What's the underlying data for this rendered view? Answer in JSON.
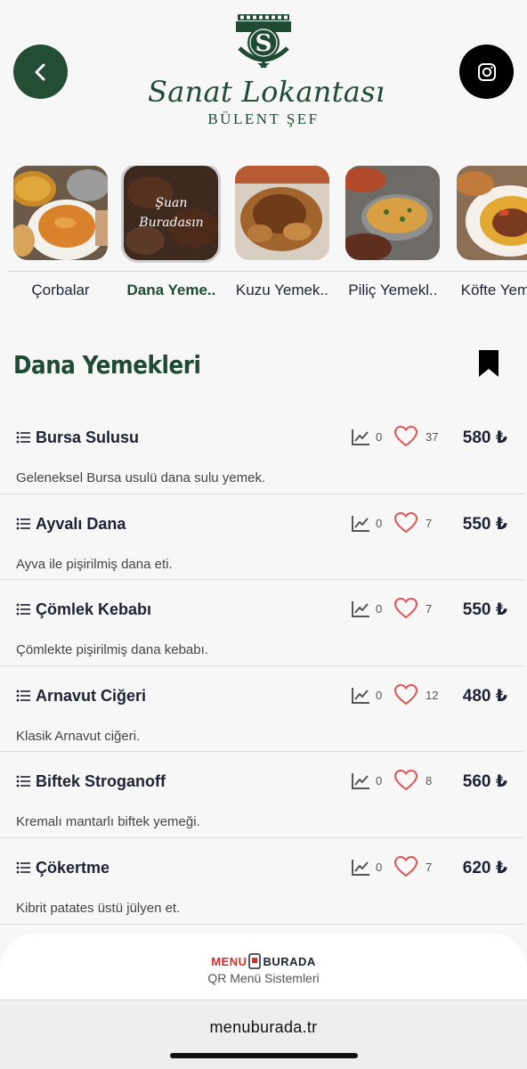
{
  "header": {
    "restaurant_name": "Sanat Lokantası",
    "chef_line": "BÜLENT ŞEF",
    "back_icon": "chevron-left-icon",
    "social_icon": "instagram-icon"
  },
  "categories": [
    {
      "label": "Çorbalar",
      "active": false,
      "overlay": ""
    },
    {
      "label": "Dana Yeme..",
      "active": true,
      "overlay_line1": "Şuan",
      "overlay_line2": "Buradasın"
    },
    {
      "label": "Kuzu Yemek..",
      "active": false
    },
    {
      "label": "Piliç Yemekl..",
      "active": false
    },
    {
      "label": "Köfte Yeme..",
      "active": false
    }
  ],
  "section": {
    "title": "Dana Yemekleri",
    "bookmark_icon": "bookmark-icon"
  },
  "items": [
    {
      "name": "Bursa Sulusu",
      "desc": "Geleneksel Bursa usulü dana sulu yemek.",
      "views": "0",
      "likes": "37",
      "price": "580 ₺"
    },
    {
      "name": "Ayvalı Dana",
      "desc": "Ayva ile pişirilmiş dana eti.",
      "views": "0",
      "likes": "7",
      "price": "550 ₺"
    },
    {
      "name": "Çömlek Kebabı",
      "desc": "Çömlekte pişirilmiş dana kebabı.",
      "views": "0",
      "likes": "7",
      "price": "550 ₺"
    },
    {
      "name": "Arnavut Ciğeri",
      "desc": "Klasik Arnavut ciğeri.",
      "views": "0",
      "likes": "12",
      "price": "480 ₺"
    },
    {
      "name": "Biftek Stroganoff",
      "desc": "Kremalı mantarlı biftek yemeği.",
      "views": "0",
      "likes": "8",
      "price": "560 ₺"
    },
    {
      "name": "Çökertme",
      "desc": "Kibrit patates üstü jülyen et.",
      "views": "0",
      "likes": "7",
      "price": "620 ₺"
    }
  ],
  "footer": {
    "brand_left": "MENU",
    "brand_right": "BURADA",
    "subtitle": "QR Menü Sistemleri",
    "domain": "menuburada.tr"
  },
  "colors": {
    "brand_green": "#1f4a33",
    "heart_red": "#e05555",
    "text_dark": "#1d2235"
  }
}
